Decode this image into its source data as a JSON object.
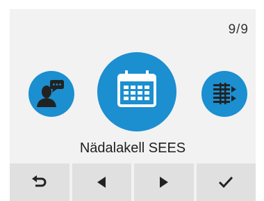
{
  "status": {
    "page_indicator": "9/9"
  },
  "menu": {
    "items": [
      {
        "icon": "person-speech-icon",
        "selected": false
      },
      {
        "icon": "calendar-icon",
        "selected": true
      },
      {
        "icon": "schedule-list-icon",
        "selected": false
      }
    ],
    "selected_label": "Nädalakell SEES"
  },
  "nav": {
    "buttons": [
      {
        "icon": "back-arrow-icon"
      },
      {
        "icon": "triangle-left-icon"
      },
      {
        "icon": "triangle-right-icon"
      },
      {
        "icon": "checkmark-icon"
      }
    ]
  },
  "colors": {
    "accent": "#1b8fd0",
    "background": "#f2f2f2",
    "button": "#e0e0e0",
    "icon_dark": "#222222"
  }
}
